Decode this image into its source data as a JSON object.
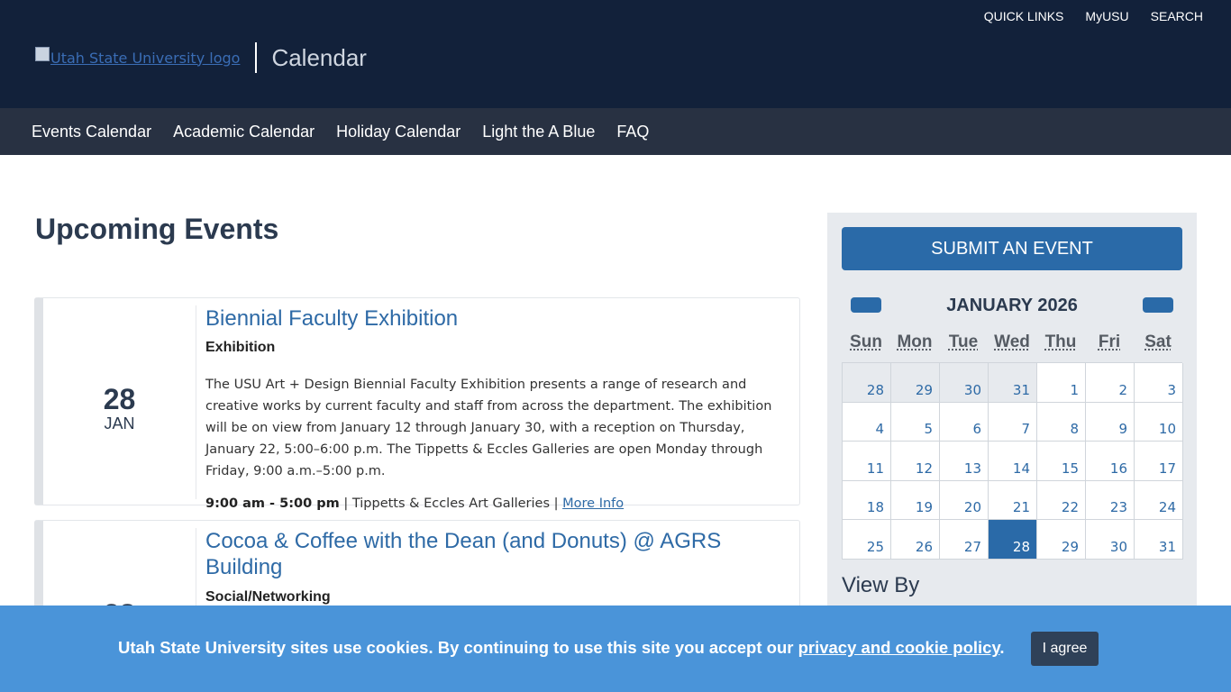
{
  "header": {
    "util_links": [
      "QUICK LINKS",
      "MyUSU",
      "SEARCH"
    ],
    "logo_alt": "Utah State University logo",
    "title": "Calendar"
  },
  "nav": {
    "items": [
      "Events Calendar",
      "Academic Calendar",
      "Holiday Calendar",
      "Light the A Blue",
      "FAQ"
    ]
  },
  "main": {
    "title": "Upcoming Events",
    "events": [
      {
        "day": "28",
        "month": "JAN",
        "title": "Biennial Faculty Exhibition",
        "category": "Exhibition",
        "description": "The USU Art + Design Biennial Faculty Exhibition presents a range of research and creative works by current faculty and staff from across the department. The exhibition will be on view from January 12 through January 30, with a reception on Thursday, January 22, 5:00–6:00 p.m. The Tippetts & Eccles Galleries are open Monday through Friday, 9:00 a.m.–5:00 p.m.",
        "time": "9:00 am - 5:00 pm",
        "location": "Tippetts & Eccles Art Galleries",
        "more": "More Info"
      },
      {
        "day": "28",
        "title": "Cocoa & Coffee with the Dean (and Donuts) @ AGRS Building",
        "category": "Social/Networking"
      }
    ]
  },
  "sidebar": {
    "submit_label": "SUBMIT AN EVENT",
    "calendar": {
      "month_label": "JANUARY 2026",
      "weekdays": [
        "Sun",
        "Mon",
        "Tue",
        "Wed",
        "Thu",
        "Fri",
        "Sat"
      ],
      "days": [
        {
          "n": "28",
          "other": true
        },
        {
          "n": "29",
          "other": true
        },
        {
          "n": "30",
          "other": true
        },
        {
          "n": "31",
          "other": true
        },
        {
          "n": "1"
        },
        {
          "n": "2"
        },
        {
          "n": "3"
        },
        {
          "n": "4"
        },
        {
          "n": "5"
        },
        {
          "n": "6"
        },
        {
          "n": "7"
        },
        {
          "n": "8"
        },
        {
          "n": "9"
        },
        {
          "n": "10"
        },
        {
          "n": "11"
        },
        {
          "n": "12"
        },
        {
          "n": "13"
        },
        {
          "n": "14"
        },
        {
          "n": "15"
        },
        {
          "n": "16"
        },
        {
          "n": "17"
        },
        {
          "n": "18"
        },
        {
          "n": "19"
        },
        {
          "n": "20"
        },
        {
          "n": "21"
        },
        {
          "n": "22"
        },
        {
          "n": "23"
        },
        {
          "n": "24"
        },
        {
          "n": "25"
        },
        {
          "n": "26"
        },
        {
          "n": "27"
        },
        {
          "n": "28",
          "today": true
        },
        {
          "n": "29"
        },
        {
          "n": "30"
        },
        {
          "n": "31"
        }
      ]
    },
    "view_by": "View By"
  },
  "cookie": {
    "text": "Utah State University sites use cookies. By continuing to use this site you accept our",
    "link": "privacy and cookie policy",
    "suffix": ".",
    "button": "I agree"
  }
}
